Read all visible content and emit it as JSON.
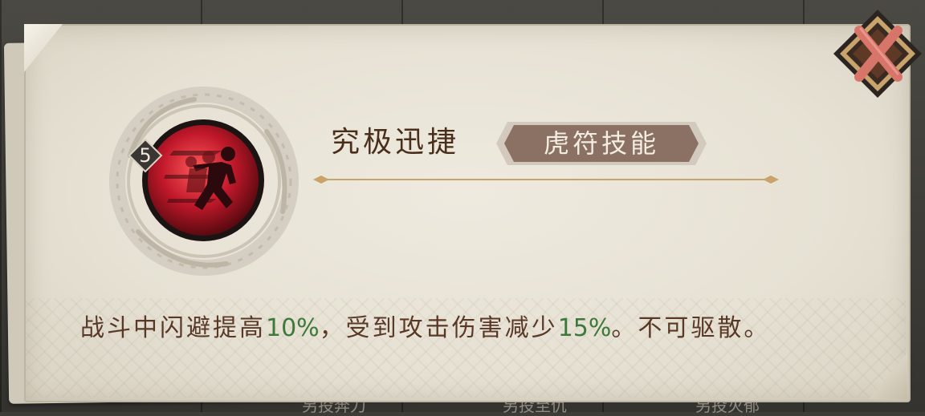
{
  "skill": {
    "level": "5",
    "name": "究极迅捷",
    "category": "虎符技能",
    "description": {
      "part1": "战斗中闪避提高",
      "value1": "10%",
      "part2": "，受到攻击伤害减少",
      "value2": "15%",
      "part3": "。不可驱散。"
    }
  },
  "background": {
    "labels": [
      "另投奔刀",
      "另投至仇",
      "另投灭郁"
    ]
  },
  "colors": {
    "paper": "#e9e5d9",
    "title": "#4a2e1c",
    "text": "#5a3826",
    "highlight": "#3d7a3a",
    "tag_bg": "#8a7164",
    "icon_red": "#c0182a",
    "close_x": "#d8756b"
  },
  "icons": {
    "close": "close-x-icon",
    "skill": "running-figure-icon",
    "ring": "dragon-ring-icon"
  }
}
